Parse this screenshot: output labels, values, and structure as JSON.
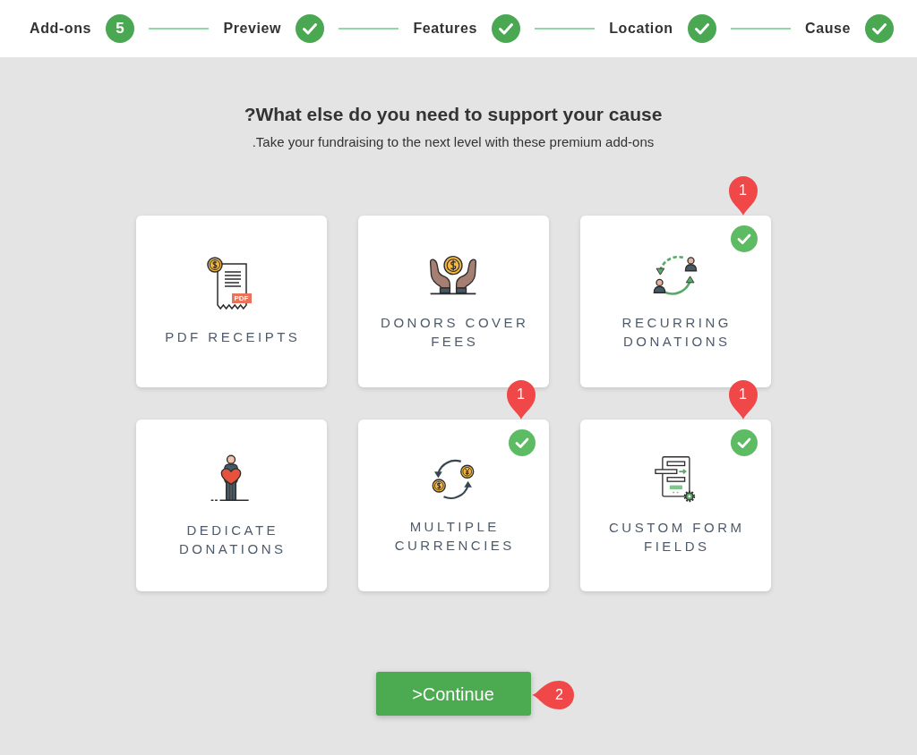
{
  "steps": [
    {
      "label": "Add-ons",
      "completed": false,
      "number": "5"
    },
    {
      "label": "Preview",
      "completed": true
    },
    {
      "label": "Features",
      "completed": true
    },
    {
      "label": "Location",
      "completed": true
    },
    {
      "label": "Cause",
      "completed": true
    }
  ],
  "heading": {
    "title": "?What else do you need to support your cause",
    "subtitle": ".Take your fundraising to the next level with these premium add-ons"
  },
  "addons": [
    {
      "label": "PDF RECEIPTS",
      "selected": false,
      "icon_tag": "PDF"
    },
    {
      "label": "DONORS COVER FEES",
      "selected": false
    },
    {
      "label": "RECURRING DONATIONS",
      "selected": true,
      "callout": "1"
    },
    {
      "label": "DEDICATE DONATIONS",
      "selected": false
    },
    {
      "label": "MULTIPLE CURRENCIES",
      "selected": true,
      "callout": "1"
    },
    {
      "label": "CUSTOM FORM FIELDS",
      "selected": true,
      "callout": "1"
    }
  ],
  "continue_button": {
    "label": ">Continue",
    "callout": "2"
  }
}
